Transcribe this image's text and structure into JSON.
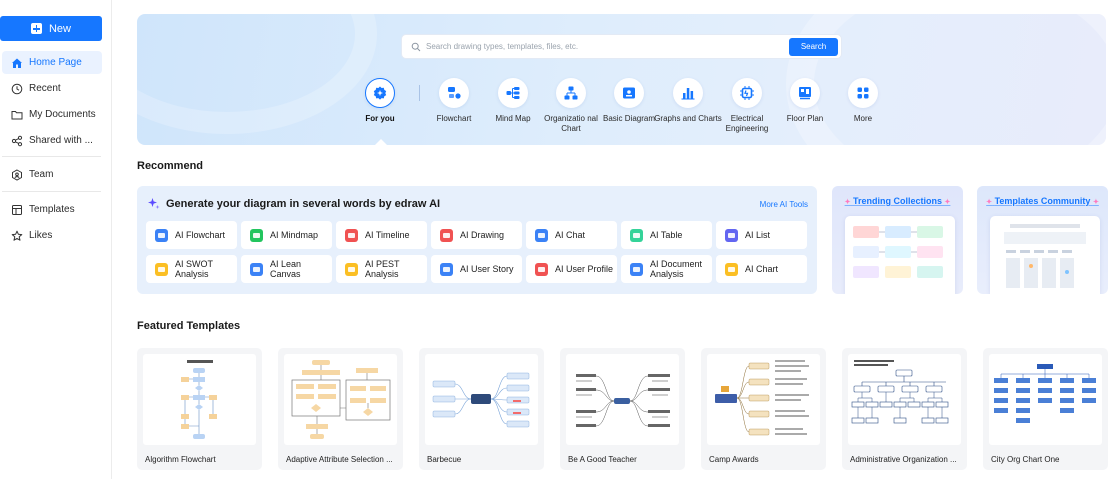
{
  "sidebar": {
    "new_label": "New",
    "items": [
      {
        "label": "Home Page",
        "icon": "home-icon"
      },
      {
        "label": "Recent",
        "icon": "clock-icon"
      },
      {
        "label": "My Documents",
        "icon": "folder-icon"
      },
      {
        "label": "Shared with ...",
        "icon": "share-icon"
      },
      {
        "label": "Team",
        "icon": "team-icon"
      },
      {
        "label": "Templates",
        "icon": "template-icon"
      },
      {
        "label": "Likes",
        "icon": "star-icon"
      }
    ]
  },
  "hero": {
    "search_placeholder": "Search drawing types, templates, files, etc.",
    "search_button": "Search",
    "categories": [
      {
        "label": "For you",
        "icon": "sparkle-badge-icon"
      },
      {
        "label": "Flowchart",
        "icon": "flowchart-icon"
      },
      {
        "label": "Mind Map",
        "icon": "mindmap-icon"
      },
      {
        "label": "Organizatio nal Chart",
        "icon": "org-chart-icon"
      },
      {
        "label": "Basic Diagram",
        "icon": "basic-diagram-icon"
      },
      {
        "label": "Graphs and Charts",
        "icon": "bar-chart-icon"
      },
      {
        "label": "Electrical Engineering",
        "icon": "circuit-icon"
      },
      {
        "label": "Floor Plan",
        "icon": "floor-plan-icon"
      },
      {
        "label": "More",
        "icon": "grid-more-icon"
      }
    ]
  },
  "recommend": {
    "title": "Recommend",
    "ai_heading": "Generate your diagram in several words by edraw AI",
    "more_ai_tools": "More AI Tools",
    "ai_tools": [
      {
        "label": "AI Flowchart",
        "color": "#3b82f6"
      },
      {
        "label": "AI Mindmap",
        "color": "#22c55e"
      },
      {
        "label": "AI Timeline",
        "color": "#f05252"
      },
      {
        "label": "AI Drawing",
        "color": "#f05252"
      },
      {
        "label": "AI Chat",
        "color": "#3b82f6"
      },
      {
        "label": "AI Table",
        "color": "#34d399"
      },
      {
        "label": "AI List",
        "color": "#6366f1"
      },
      {
        "label": "AI SWOT Analysis",
        "color": "#fbbf24"
      },
      {
        "label": "AI Lean Canvas",
        "color": "#3b82f6"
      },
      {
        "label": "AI PEST Analysis",
        "color": "#fbbf24"
      },
      {
        "label": "AI User Story",
        "color": "#3b82f6"
      },
      {
        "label": "AI User Profile",
        "color": "#f05252"
      },
      {
        "label": "AI Document Analysis",
        "color": "#3b82f6"
      },
      {
        "label": "AI Chart",
        "color": "#fbbf24"
      }
    ],
    "collections": [
      {
        "title": "Trending Collections"
      },
      {
        "title": "Templates Community"
      }
    ]
  },
  "featured": {
    "title": "Featured Templates",
    "templates": [
      {
        "name": "Algorithm Flowchart"
      },
      {
        "name": "Adaptive Attribute Selection ..."
      },
      {
        "name": "Barbecue"
      },
      {
        "name": "Be A Good Teacher"
      },
      {
        "name": "Camp Awards"
      },
      {
        "name": "Administrative Organization ..."
      },
      {
        "name": "City Org Chart One"
      }
    ]
  },
  "colors": {
    "accent": "#1677ff"
  }
}
